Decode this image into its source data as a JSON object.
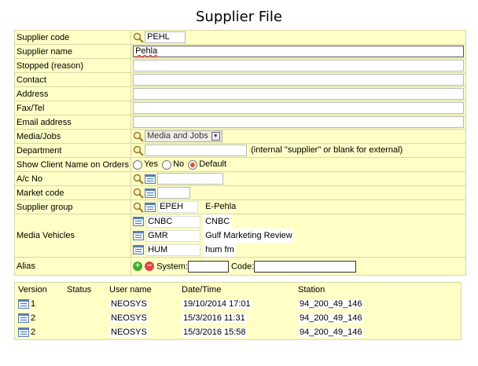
{
  "page_title": "Supplier File",
  "fields": {
    "supplier_code": {
      "label": "Supplier code",
      "value": "PEHL"
    },
    "supplier_name": {
      "label": "Supplier name",
      "value": "Pehla"
    },
    "stopped": {
      "label": "Stopped (reason)",
      "value": ""
    },
    "contact": {
      "label": "Contact",
      "value": ""
    },
    "address": {
      "label": "Address",
      "value": ""
    },
    "fax_tel": {
      "label": "Fax/Tel",
      "value": ""
    },
    "email": {
      "label": "Email address",
      "value": ""
    },
    "media_jobs": {
      "label": "Media/Jobs",
      "selected": "Media and Jobs"
    },
    "department": {
      "label": "Department",
      "value": "",
      "hint": "(internal \"supplier\" or blank for external)"
    },
    "show_client": {
      "label": "Show Client Name on Orders",
      "options": [
        "Yes",
        "No",
        "Default"
      ],
      "selected": "Default"
    },
    "ac_no": {
      "label": "A/c No",
      "value": ""
    },
    "market_code": {
      "label": "Market code",
      "value": ""
    },
    "supplier_group": {
      "label": "Supplier group",
      "code": "EPEH",
      "name": "E-Pehla"
    },
    "media_vehicles": {
      "label": "Media Vehicles",
      "items": [
        {
          "code": "CNBC",
          "name": "CNBC"
        },
        {
          "code": "GMR",
          "name": "Gulf Marketing Review"
        },
        {
          "code": "HUM",
          "name": "hum fm"
        }
      ]
    },
    "alias": {
      "label": "Alias",
      "system_label": "System:",
      "code_label": "Code:",
      "system_value": "",
      "code_value": ""
    }
  },
  "versions": {
    "headers": [
      "Version",
      "Status",
      "User name",
      "Date/Time",
      "Station"
    ],
    "rows": [
      {
        "version": "1",
        "status": "",
        "user": "NEOSYS",
        "datetime": "19/10/2014 17:01",
        "station": "94_200_49_146"
      },
      {
        "version": "2",
        "status": "",
        "user": "NEOSYS",
        "datetime": "15/3/2016 11:31",
        "station": "94_200_49_146"
      },
      {
        "version": "2",
        "status": "",
        "user": "NEOSYS",
        "datetime": "15/3/2016 15:58",
        "station": "94_200_49_146"
      }
    ]
  },
  "colors": {
    "form_bg": "#ffffc6",
    "border": "#d8d6a8",
    "radio_selected": "#e2522a",
    "add": "#3fae29",
    "remove": "#e04545"
  },
  "icons": [
    "magnifier-icon",
    "list-icon",
    "add-icon",
    "remove-icon",
    "dropdown-arrow-icon"
  ]
}
